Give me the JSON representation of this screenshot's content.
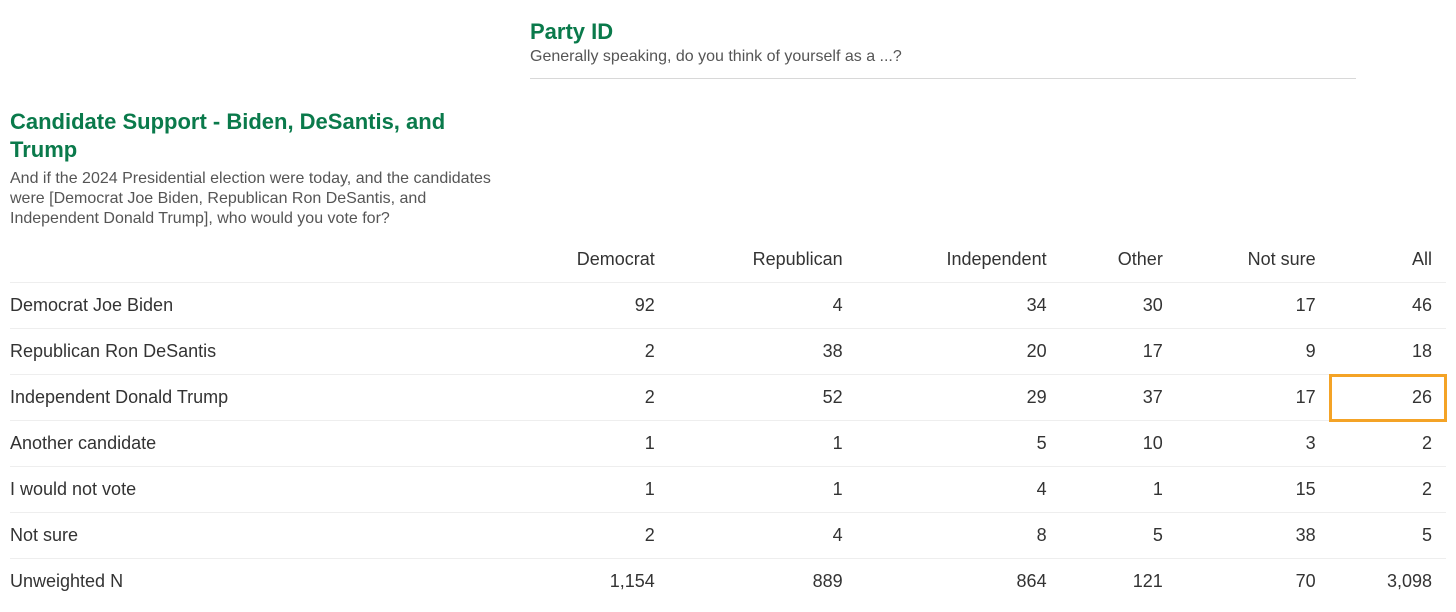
{
  "column_group": {
    "title": "Party ID",
    "subtitle": "Generally speaking, do you think of yourself as a ...?"
  },
  "row_group": {
    "title": "Candidate Support - Biden, DeSantis, and Trump",
    "subtitle": "And if the 2024 Presidential election were today, and the candidates were [Democrat Joe Biden, Republican Ron DeSantis, and Independent Donald Trump], who would you vote for?"
  },
  "columns": [
    "Democrat",
    "Republican",
    "Independent",
    "Other",
    "Not sure",
    "All"
  ],
  "rows": [
    {
      "label": "Democrat Joe Biden",
      "values": [
        "92",
        "4",
        "34",
        "30",
        "17",
        "46"
      ]
    },
    {
      "label": "Republican Ron DeSantis",
      "values": [
        "2",
        "38",
        "20",
        "17",
        "9",
        "18"
      ]
    },
    {
      "label": "Independent Donald Trump",
      "values": [
        "2",
        "52",
        "29",
        "37",
        "17",
        "26"
      ],
      "highlight_col": 5
    },
    {
      "label": "Another candidate",
      "values": [
        "1",
        "1",
        "5",
        "10",
        "3",
        "2"
      ]
    },
    {
      "label": "I would not vote",
      "values": [
        "1",
        "1",
        "4",
        "1",
        "15",
        "2"
      ]
    },
    {
      "label": "Not sure",
      "values": [
        "2",
        "4",
        "8",
        "5",
        "38",
        "5"
      ]
    },
    {
      "label": "Unweighted N",
      "values": [
        "1,154",
        "889",
        "864",
        "121",
        "70",
        "3,098"
      ]
    }
  ],
  "chart_data": {
    "type": "table",
    "title": "Candidate Support - Biden, DeSantis, and Trump × Party ID crosstab",
    "columns": [
      "Democrat",
      "Republican",
      "Independent",
      "Other",
      "Not sure",
      "All"
    ],
    "rows": [
      {
        "label": "Democrat Joe Biden",
        "values": [
          92,
          4,
          34,
          30,
          17,
          46
        ]
      },
      {
        "label": "Republican Ron DeSantis",
        "values": [
          2,
          38,
          20,
          17,
          9,
          18
        ]
      },
      {
        "label": "Independent Donald Trump",
        "values": [
          2,
          52,
          29,
          37,
          17,
          26
        ]
      },
      {
        "label": "Another candidate",
        "values": [
          1,
          1,
          5,
          10,
          3,
          2
        ]
      },
      {
        "label": "I would not vote",
        "values": [
          1,
          1,
          4,
          1,
          15,
          2
        ]
      },
      {
        "label": "Not sure",
        "values": [
          2,
          4,
          8,
          5,
          38,
          5
        ]
      },
      {
        "label": "Unweighted N",
        "values": [
          1154,
          889,
          864,
          121,
          70,
          3098
        ]
      }
    ],
    "highlighted_cell": {
      "row": "Independent Donald Trump",
      "column": "All",
      "value": 26
    },
    "unit": "percent (rows except Unweighted N)"
  }
}
